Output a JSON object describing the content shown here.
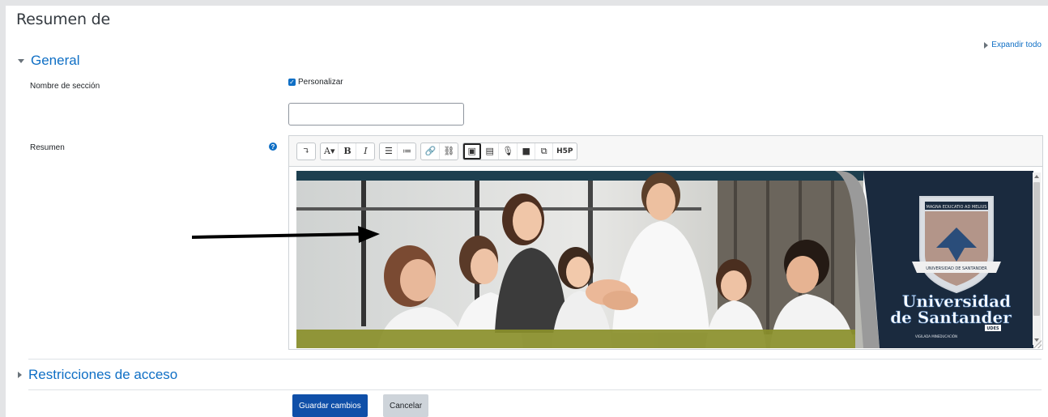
{
  "page": {
    "title": "Resumen de",
    "expand_all": "Expandir todo"
  },
  "sections": {
    "general": "General",
    "restricciones": "Restricciones de acceso"
  },
  "form": {
    "nombre_label": "Nombre de sección",
    "personalizar_label": "Personalizar",
    "personalizar_checked": true,
    "nombre_value": "",
    "resumen_label": "Resumen",
    "help_glyph": "?"
  },
  "toolbar": {
    "groups": [
      [
        {
          "icon": "toggle-toolbar-icon",
          "glyph": "↴"
        }
      ],
      [
        {
          "icon": "font-size-icon",
          "glyph": "A▾"
        },
        {
          "icon": "bold-icon",
          "glyph": "B"
        },
        {
          "icon": "italic-icon",
          "glyph": "I"
        }
      ],
      [
        {
          "icon": "unordered-list-icon",
          "glyph": "☰"
        },
        {
          "icon": "ordered-list-icon",
          "glyph": "≔"
        }
      ],
      [
        {
          "icon": "link-icon",
          "glyph": "🔗"
        },
        {
          "icon": "unlink-icon",
          "glyph": "⛓"
        }
      ],
      [
        {
          "icon": "image-icon",
          "glyph": "▣",
          "active": true
        },
        {
          "icon": "media-icon",
          "glyph": "▤"
        },
        {
          "icon": "record-audio-icon",
          "glyph": "🎙"
        },
        {
          "icon": "record-video-icon",
          "glyph": "■"
        },
        {
          "icon": "manage-files-icon",
          "glyph": "⧉"
        },
        {
          "icon": "h5p-icon",
          "glyph": "H5P"
        }
      ]
    ]
  },
  "banner": {
    "logo_top": "MAGNA EDUCATIO AD MELIUS",
    "logo_ribbon": "UNIVERSIDAD DE SANTANDER",
    "logo_name_1": "Universidad",
    "logo_name_2": "de Santander",
    "logo_badge": "UDES",
    "logo_footer": "VIGILADA MINEDUCACIÓN",
    "colors": {
      "navy": "#1a2a3e",
      "olive": "#8a8f2a",
      "teal": "#1d3f4f"
    }
  },
  "buttons": {
    "save": "Guardar cambios",
    "cancel": "Cancelar"
  }
}
